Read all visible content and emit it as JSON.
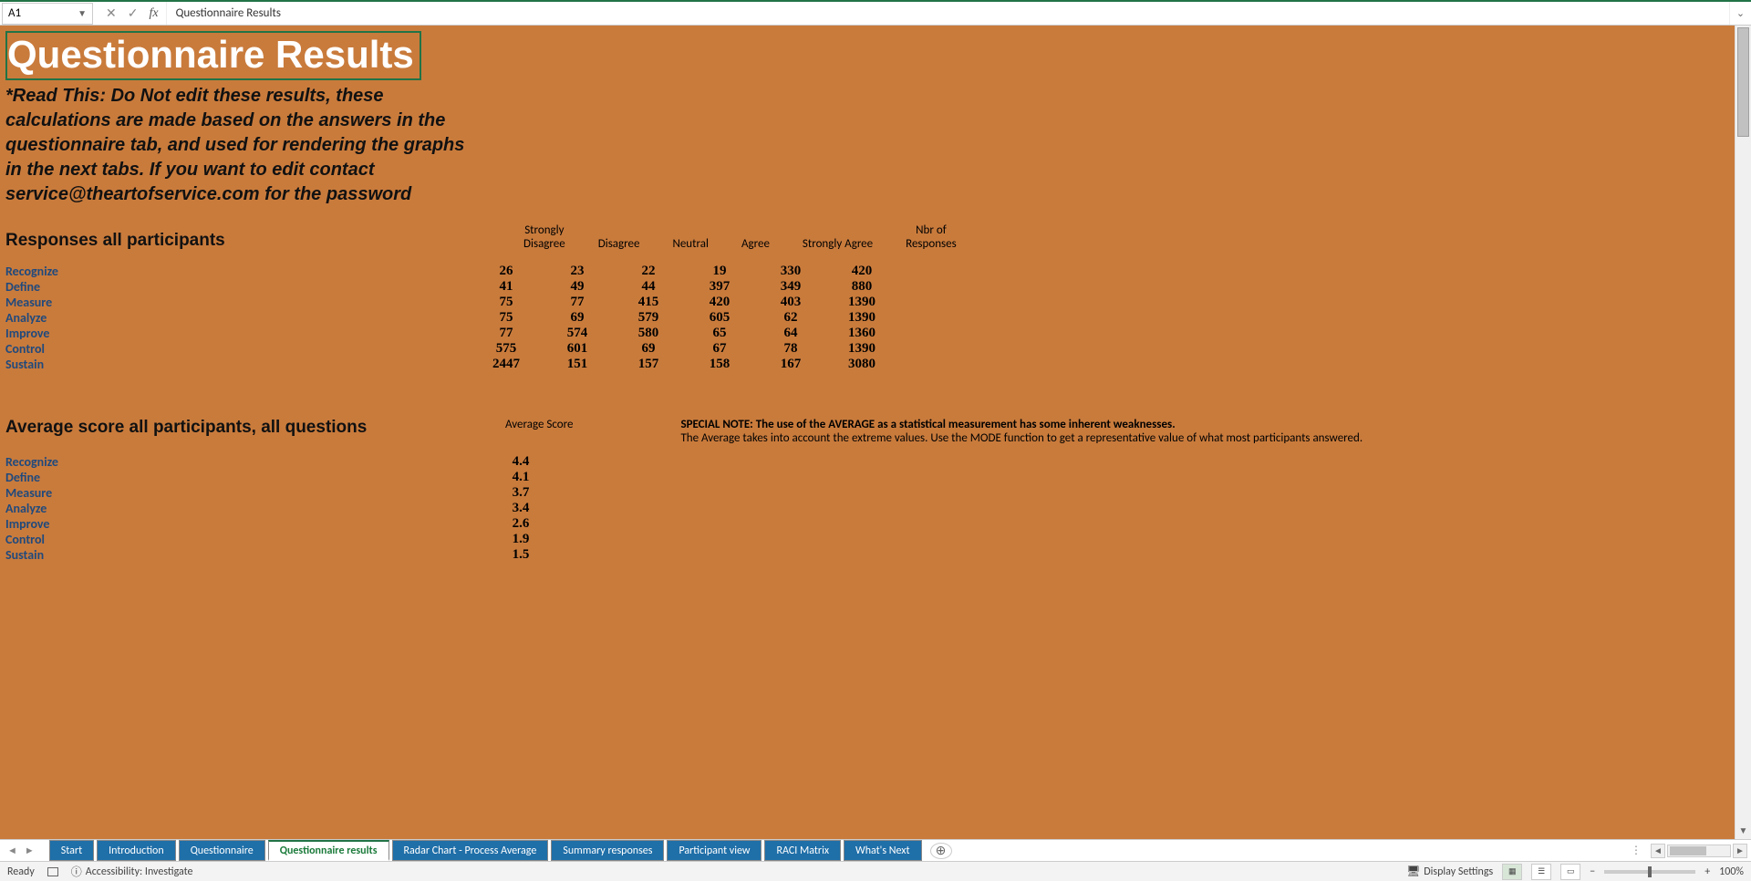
{
  "formula_bar": {
    "cell_ref": "A1",
    "content": "Questionnaire Results"
  },
  "sheet": {
    "title": "Questionnaire Results",
    "read_note": "*Read This: Do Not edit these results, these calculations are made based on the answers in the questionnaire tab, and used for rendering the graphs in the next tabs. If you want to edit contact service@theartofservice.com for the password",
    "responses_heading": "Responses all participants",
    "responses_headers": [
      "Strongly Disagree",
      "Disagree",
      "Neutral",
      "Agree",
      "Strongly Agree",
      "Nbr of Responses"
    ],
    "responses_rows": [
      {
        "label": "Recognize",
        "v": [
          "26",
          "23",
          "22",
          "19",
          "330",
          "420"
        ]
      },
      {
        "label": "Define",
        "v": [
          "41",
          "49",
          "44",
          "397",
          "349",
          "880"
        ]
      },
      {
        "label": "Measure",
        "v": [
          "75",
          "77",
          "415",
          "420",
          "403",
          "1390"
        ]
      },
      {
        "label": "Analyze",
        "v": [
          "75",
          "69",
          "579",
          "605",
          "62",
          "1390"
        ]
      },
      {
        "label": "Improve",
        "v": [
          "77",
          "574",
          "580",
          "65",
          "64",
          "1360"
        ]
      },
      {
        "label": "Control",
        "v": [
          "575",
          "601",
          "69",
          "67",
          "78",
          "1390"
        ]
      },
      {
        "label": "Sustain",
        "v": [
          "2447",
          "151",
          "157",
          "158",
          "167",
          "3080"
        ]
      }
    ],
    "avg_heading": "Average score all participants, all questions",
    "avg_col_header": "Average Score",
    "avg_rows": [
      {
        "label": "Recognize",
        "v": "4.4"
      },
      {
        "label": "Define",
        "v": "4.1"
      },
      {
        "label": "Measure",
        "v": "3.7"
      },
      {
        "label": "Analyze",
        "v": "3.4"
      },
      {
        "label": "Improve",
        "v": "2.6"
      },
      {
        "label": "Control",
        "v": "1.9"
      },
      {
        "label": "Sustain",
        "v": "1.5"
      }
    ],
    "special_note_bold": "SPECIAL NOTE: The use of the AVERAGE as a statistical measurement has some inherent weaknesses.",
    "special_note_text": "The Average takes into account the extreme values. Use the MODE function to get a representative value of what most participants answered."
  },
  "tabs": [
    {
      "label": "Start",
      "active": false
    },
    {
      "label": "Introduction",
      "active": false
    },
    {
      "label": "Questionnaire",
      "active": false
    },
    {
      "label": "Questionnaire results",
      "active": true
    },
    {
      "label": "Radar Chart - Process Average",
      "active": false
    },
    {
      "label": "Summary responses",
      "active": false
    },
    {
      "label": "Participant view",
      "active": false
    },
    {
      "label": "RACI Matrix",
      "active": false
    },
    {
      "label": "What's Next",
      "active": false
    }
  ],
  "status": {
    "ready": "Ready",
    "accessibility": "Accessibility: Investigate",
    "display_settings": "Display Settings",
    "zoom": "100%"
  },
  "chart_data": [
    {
      "type": "table",
      "title": "Responses all participants",
      "categories": [
        "Recognize",
        "Define",
        "Measure",
        "Analyze",
        "Improve",
        "Control",
        "Sustain"
      ],
      "series": [
        {
          "name": "Strongly Disagree",
          "values": [
            26,
            41,
            75,
            75,
            77,
            575,
            2447
          ]
        },
        {
          "name": "Disagree",
          "values": [
            23,
            49,
            77,
            69,
            574,
            601,
            151
          ]
        },
        {
          "name": "Neutral",
          "values": [
            22,
            44,
            415,
            579,
            580,
            69,
            157
          ]
        },
        {
          "name": "Agree",
          "values": [
            19,
            397,
            420,
            605,
            65,
            67,
            158
          ]
        },
        {
          "name": "Strongly Agree",
          "values": [
            330,
            349,
            403,
            62,
            64,
            78,
            167
          ]
        },
        {
          "name": "Nbr of Responses",
          "values": [
            420,
            880,
            1390,
            1390,
            1360,
            1390,
            3080
          ]
        }
      ]
    },
    {
      "type": "table",
      "title": "Average score all participants, all questions",
      "categories": [
        "Recognize",
        "Define",
        "Measure",
        "Analyze",
        "Improve",
        "Control",
        "Sustain"
      ],
      "series": [
        {
          "name": "Average Score",
          "values": [
            4.4,
            4.1,
            3.7,
            3.4,
            2.6,
            1.9,
            1.5
          ]
        }
      ]
    }
  ]
}
